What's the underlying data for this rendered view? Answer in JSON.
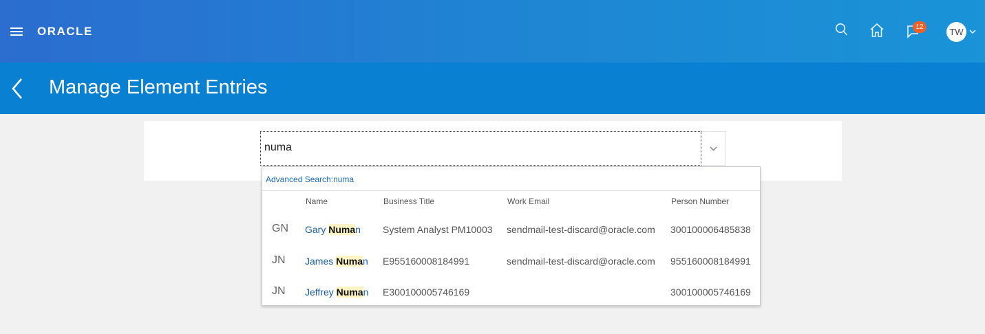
{
  "header": {
    "brand": "ORACLE",
    "notifications_count": "12",
    "user_initials": "TW",
    "icons": [
      "hamburger-menu-icon",
      "search-icon",
      "home-icon",
      "notifications-icon",
      "chevron-down-icon"
    ]
  },
  "page": {
    "title": "Manage Element Entries"
  },
  "search": {
    "value": "numa"
  },
  "suggestions": {
    "advanced_search_label": "Advanced Search:numa",
    "columns": {
      "name": "Name",
      "business_title": "Business Title",
      "work_email": "Work Email",
      "person_number": "Person Number"
    },
    "rows": [
      {
        "initials": "GN",
        "name_prefix": "Gary ",
        "name_match": "Numa",
        "name_suffix": "n",
        "business_title": "System Analyst PM10003",
        "work_email": "sendmail-test-discard@oracle.com",
        "person_number": "300100006485838"
      },
      {
        "initials": "JN",
        "name_prefix": "James ",
        "name_match": "Numa",
        "name_suffix": "n",
        "business_title": "E955160008184991",
        "work_email": "sendmail-test-discard@oracle.com",
        "person_number": "955160008184991"
      },
      {
        "initials": "JN",
        "name_prefix": "Jeffrey ",
        "name_match": "Numa",
        "name_suffix": "n",
        "business_title": "E300100005746169",
        "work_email": "",
        "person_number": "300100005746169"
      }
    ]
  },
  "colors": {
    "header_gradient_start": "#2b6dd0",
    "header_gradient_end": "#1a93d8",
    "title_bar": "#0a80d3",
    "badge": "#f0612a",
    "link": "#1a5fa9",
    "match_highlight": "#fdf3c3"
  }
}
